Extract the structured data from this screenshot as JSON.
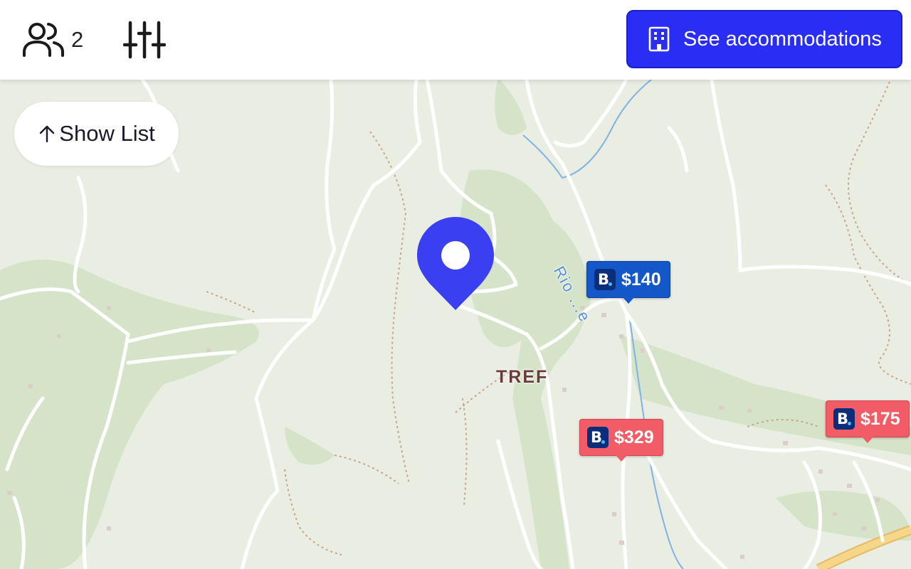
{
  "topbar": {
    "guests_count": "2",
    "cta_label": "See accommodations"
  },
  "map": {
    "show_list_label": "Show List",
    "place_label": "TREF",
    "river_label": "Rio ...e"
  },
  "listings": [
    {
      "price": "$140",
      "provider_icon": "booking-logo-icon",
      "status": "selected",
      "color": "#1357c8"
    },
    {
      "price": "$329",
      "provider_icon": "booking-logo-icon",
      "status": "default",
      "color": "#f25c66"
    },
    {
      "price": "$175",
      "provider_icon": "booking-logo-icon",
      "status": "default",
      "color": "#f25c66"
    }
  ],
  "colors": {
    "accent": "#2a2ef5",
    "map_background": "#e9ede2",
    "forest": "#d3e2c6",
    "road": "#ffffff",
    "trail": "#c9a58c",
    "water": "#7fb3e6",
    "highway": "#f5d78a"
  }
}
